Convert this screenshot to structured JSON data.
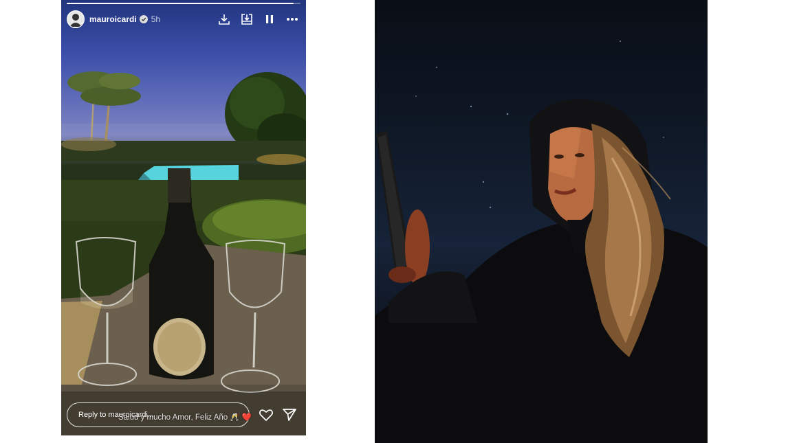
{
  "story": {
    "username": "mauroicardi",
    "time": "5h",
    "reply_placeholder": "Reply to mauroicardi...",
    "caption": "Salud y mucho Amor, Feliz Año 🥂",
    "caption_emoji": "❤️",
    "progress": 0.97,
    "icons": [
      "download-icon",
      "save-icon",
      "pause-icon",
      "more-icon",
      "heart-icon",
      "send-icon",
      "verified-badge-icon"
    ]
  },
  "colors": {
    "text": "#ffffff",
    "heart": "#d7263d"
  }
}
